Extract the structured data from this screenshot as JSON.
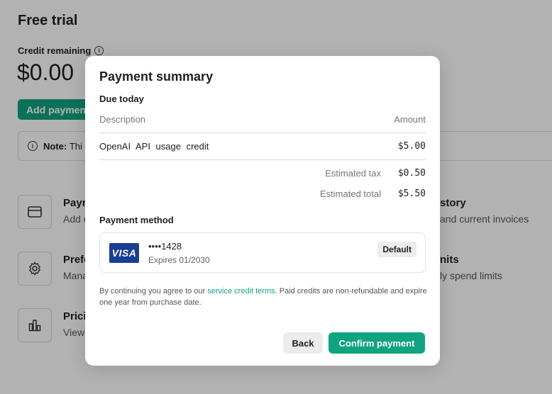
{
  "background": {
    "page_title": "Free trial",
    "credit_label": "Credit remaining",
    "credit_value": "$0.00",
    "add_payment_label": "Add payment",
    "note_label": "Note:",
    "note_text": "Thi",
    "cards": [
      {
        "title": "Payr",
        "subtitle": "Add c",
        "icon": "credit-card-icon"
      },
      {
        "title": "Prefe",
        "subtitle": "Mana",
        "icon": "gear-icon"
      },
      {
        "title": "Prici",
        "subtitle": "View",
        "icon": "bar-chart-icon"
      }
    ],
    "right_cards": [
      {
        "title": "story",
        "subtitle": "and current invoices"
      },
      {
        "title": "nits",
        "subtitle": "ly spend limits"
      }
    ]
  },
  "modal": {
    "title": "Payment summary",
    "due_today": "Due today",
    "col_description": "Description",
    "col_amount": "Amount",
    "item_description": "OpenAI API usage credit",
    "item_amount": "$5.00",
    "tax_label": "Estimated tax",
    "tax_value": "$0.50",
    "total_label": "Estimated total",
    "total_value": "$5.50",
    "payment_method_label": "Payment method",
    "card_brand": "VISA",
    "card_number": "••••1428",
    "card_expiry": "Expires 01/2030",
    "default_badge": "Default",
    "terms_prefix": "By continuing you agree to our ",
    "terms_link": "service credit terms",
    "terms_suffix": ". Paid credits are non-refundable and expire one year from purchase date.",
    "back_label": "Back",
    "confirm_label": "Confirm payment"
  },
  "colors": {
    "accent": "#10a37f",
    "visa_blue": "#1a3f91"
  }
}
